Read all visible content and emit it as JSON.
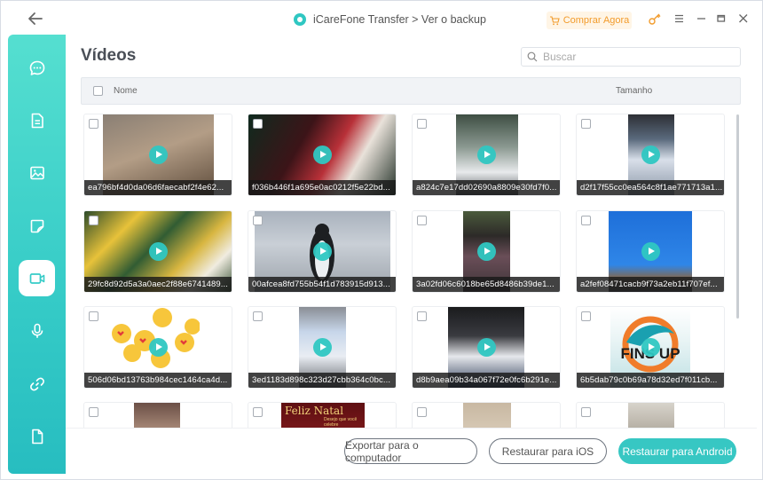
{
  "titlebar": {
    "title": "iCareFone Transfer > Ver o backup",
    "buy_label": "Comprar Agora"
  },
  "sidebar": {
    "items": [
      {
        "name": "messages"
      },
      {
        "name": "documents"
      },
      {
        "name": "photos"
      },
      {
        "name": "stickers"
      },
      {
        "name": "videos",
        "active": true
      },
      {
        "name": "audio"
      },
      {
        "name": "links"
      },
      {
        "name": "files"
      }
    ]
  },
  "main": {
    "title": "Vídeos",
    "search_placeholder": "Buscar",
    "columns": {
      "name": "Nome",
      "size": "Tamanho"
    }
  },
  "videos": [
    {
      "name": "ea796bf4d0da06d6faecabf2f4e62..."
    },
    {
      "name": "f036b446f1a695e0ac0212f5e22bd..."
    },
    {
      "name": "a824c7e17dd02690a8809e30fd7f0..."
    },
    {
      "name": "d2f17f55cc0ea564c8f1ae771713a1..."
    },
    {
      "name": "29fc8d92d5a3a0aec2f88e6741489..."
    },
    {
      "name": "00afcea8fd755b54f1d783915d913..."
    },
    {
      "name": "3a02fd06c6018be65d8486b39de1..."
    },
    {
      "name": "a2fef08471cacb9f73a2eb11f707ef..."
    },
    {
      "name": "506d06bd13763b984cec1464ca4d..."
    },
    {
      "name": "3ed1183d898c323d27cbb364c0bc..."
    },
    {
      "name": "d8b9aea09b34a067f72e0fc6b291e..."
    },
    {
      "name": "6b5dab79c0b69a78d32ed7f011cb..."
    },
    {
      "name": ""
    },
    {
      "name": "",
      "overlay_text": "Feliz Natal",
      "overlay_sub": "Desejo que você celebre"
    },
    {
      "name": ""
    },
    {
      "name": ""
    }
  ],
  "footer": {
    "export_label": "Exportar para o computador",
    "restore_ios_label": "Restaurar para iOS",
    "restore_android_label": "Restaurar para Android"
  },
  "colors": {
    "accent": "#37c7c3",
    "buy": "#f29b2b",
    "sidebar_top": "#55dfd0",
    "sidebar_bottom": "#27bdc0"
  }
}
